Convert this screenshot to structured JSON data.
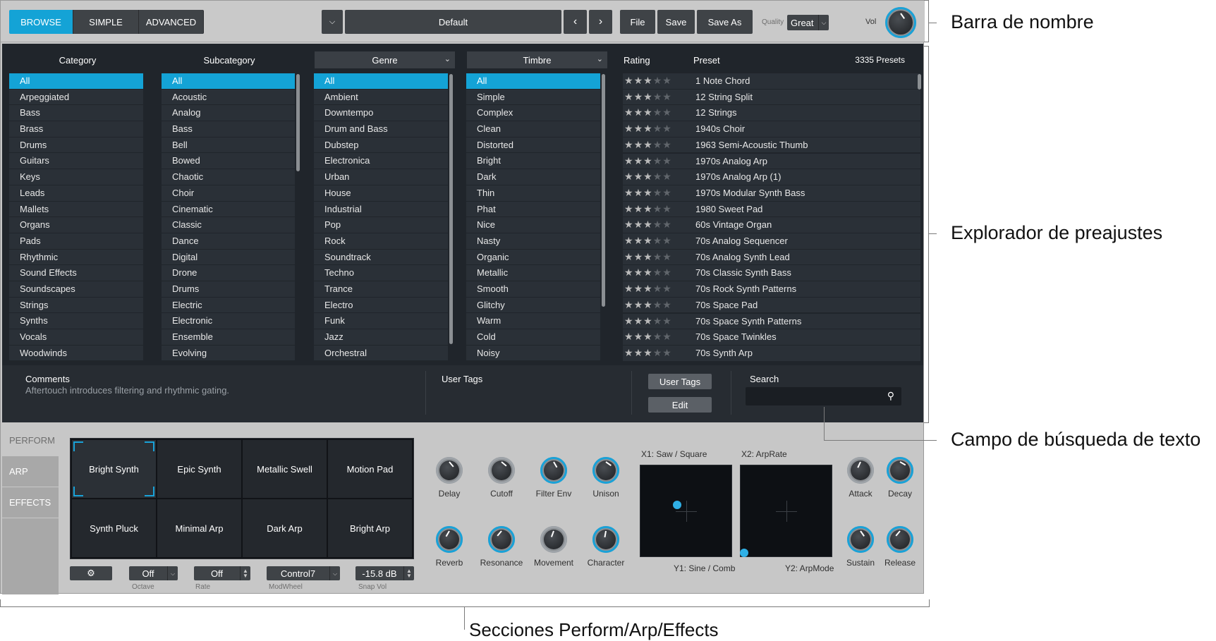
{
  "topbar": {
    "modes": [
      {
        "label": "BROWSE",
        "active": true
      },
      {
        "label": "SIMPLE",
        "active": false
      },
      {
        "label": "ADVANCED",
        "active": false
      }
    ],
    "preset_name": "Default",
    "file_label": "File",
    "save_label": "Save",
    "saveas_label": "Save As",
    "quality_label": "Quality",
    "quality_value": "Great",
    "vol_label": "Vol"
  },
  "browser": {
    "category_header": "Category",
    "subcategory_header": "Subcategory",
    "genre_header": "Genre",
    "timbre_header": "Timbre",
    "rating_header": "Rating",
    "preset_header": "Preset",
    "preset_count": "3335 Presets",
    "categories": [
      "All",
      "Arpeggiated",
      "Bass",
      "Brass",
      "Drums",
      "Guitars",
      "Keys",
      "Leads",
      "Mallets",
      "Organs",
      "Pads",
      "Rhythmic",
      "Sound Effects",
      "Soundscapes",
      "Strings",
      "Synths",
      "Vocals",
      "Woodwinds"
    ],
    "subcategories": [
      "All",
      "Acoustic",
      "Analog",
      "Bass",
      "Bell",
      "Bowed",
      "Chaotic",
      "Choir",
      "Cinematic",
      "Classic",
      "Dance",
      "Digital",
      "Drone",
      "Drums",
      "Electric",
      "Electronic",
      "Ensemble",
      "Evolving"
    ],
    "genres": [
      "All",
      "Ambient",
      "Downtempo",
      "Drum and Bass",
      "Dubstep",
      "Electronica",
      "Urban",
      "House",
      "Industrial",
      "Pop",
      "Rock",
      "Soundtrack",
      "Techno",
      "Trance",
      "Electro",
      "Funk",
      "Jazz",
      "Orchestral"
    ],
    "timbres": [
      "All",
      "Simple",
      "Complex",
      "Clean",
      "Distorted",
      "Bright",
      "Dark",
      "Thin",
      "Phat",
      "Nice",
      "Nasty",
      "Organic",
      "Metallic",
      "Smooth",
      "Glitchy",
      "Warm",
      "Cold",
      "Noisy"
    ],
    "presets": [
      "1 Note Chord",
      "12 String Split",
      "12 Strings",
      "1940s Choir",
      "1963 Semi-Acoustic Thumb",
      "1970s Analog Arp",
      "1970s Analog Arp (1)",
      "1970s Modular Synth Bass",
      "1980 Sweet Pad",
      "60s Vintage Organ",
      "70s Analog Sequencer",
      "70s Analog Synth Lead",
      "70s Classic Synth Bass",
      "70s Rock Synth Patterns",
      "70s Space Pad",
      "70s Space Synth Patterns",
      "70s Space Twinkles",
      "70s Synth Arp"
    ],
    "ratings": [
      3,
      3,
      3,
      3,
      3,
      3,
      3,
      3,
      3,
      3,
      3,
      3,
      3,
      3,
      3,
      3,
      3,
      3
    ],
    "comments_label": "Comments",
    "comments_text": "Aftertouch introduces filtering and rhythmic gating.",
    "usertags_label": "User Tags",
    "usertags_button": "User Tags",
    "edit_button": "Edit",
    "search_label": "Search"
  },
  "perform": {
    "tabs": [
      {
        "label": "PERFORM",
        "active": true
      },
      {
        "label": "ARP",
        "active": false
      },
      {
        "label": "EFFECTS",
        "active": false
      }
    ],
    "pads": [
      "Bright Synth",
      "Epic Synth",
      "Metallic Swell",
      "Motion Pad",
      "Synth Pluck",
      "Minimal Arp",
      "Dark Arp",
      "Bright Arp"
    ],
    "knobs_row1": [
      "Delay",
      "Cutoff",
      "Filter Env",
      "Unison"
    ],
    "knobs_row2": [
      "Reverb",
      "Resonance",
      "Movement",
      "Character"
    ],
    "env_knobs_row1": [
      "Attack",
      "Decay"
    ],
    "env_knobs_row2": [
      "Sustain",
      "Release"
    ],
    "octave_value": "Off",
    "octave_label": "Octave",
    "rate_value": "Off",
    "rate_label": "Rate",
    "modwheel_value": "Control7",
    "modwheel_label": "ModWheel",
    "snapvol_value": "-15.8 dB",
    "snapvol_label": "Snap Vol",
    "xy1_x_label": "X1: Saw / Square",
    "xy1_y_label": "Y1: Sine / Comb",
    "xy2_x_label": "X2: ArpRate",
    "xy2_y_label": "Y2: ArpMode"
  },
  "callouts": {
    "name_bar": "Barra de nombre",
    "preset_browser": "Explorador de preajustes",
    "search_field": "Campo de búsqueda de texto",
    "sections": "Secciones Perform/Arp/Effects"
  },
  "colors": {
    "accent": "#14a3d6",
    "panel": "#20252b",
    "chrome": "#c7c7c7"
  }
}
